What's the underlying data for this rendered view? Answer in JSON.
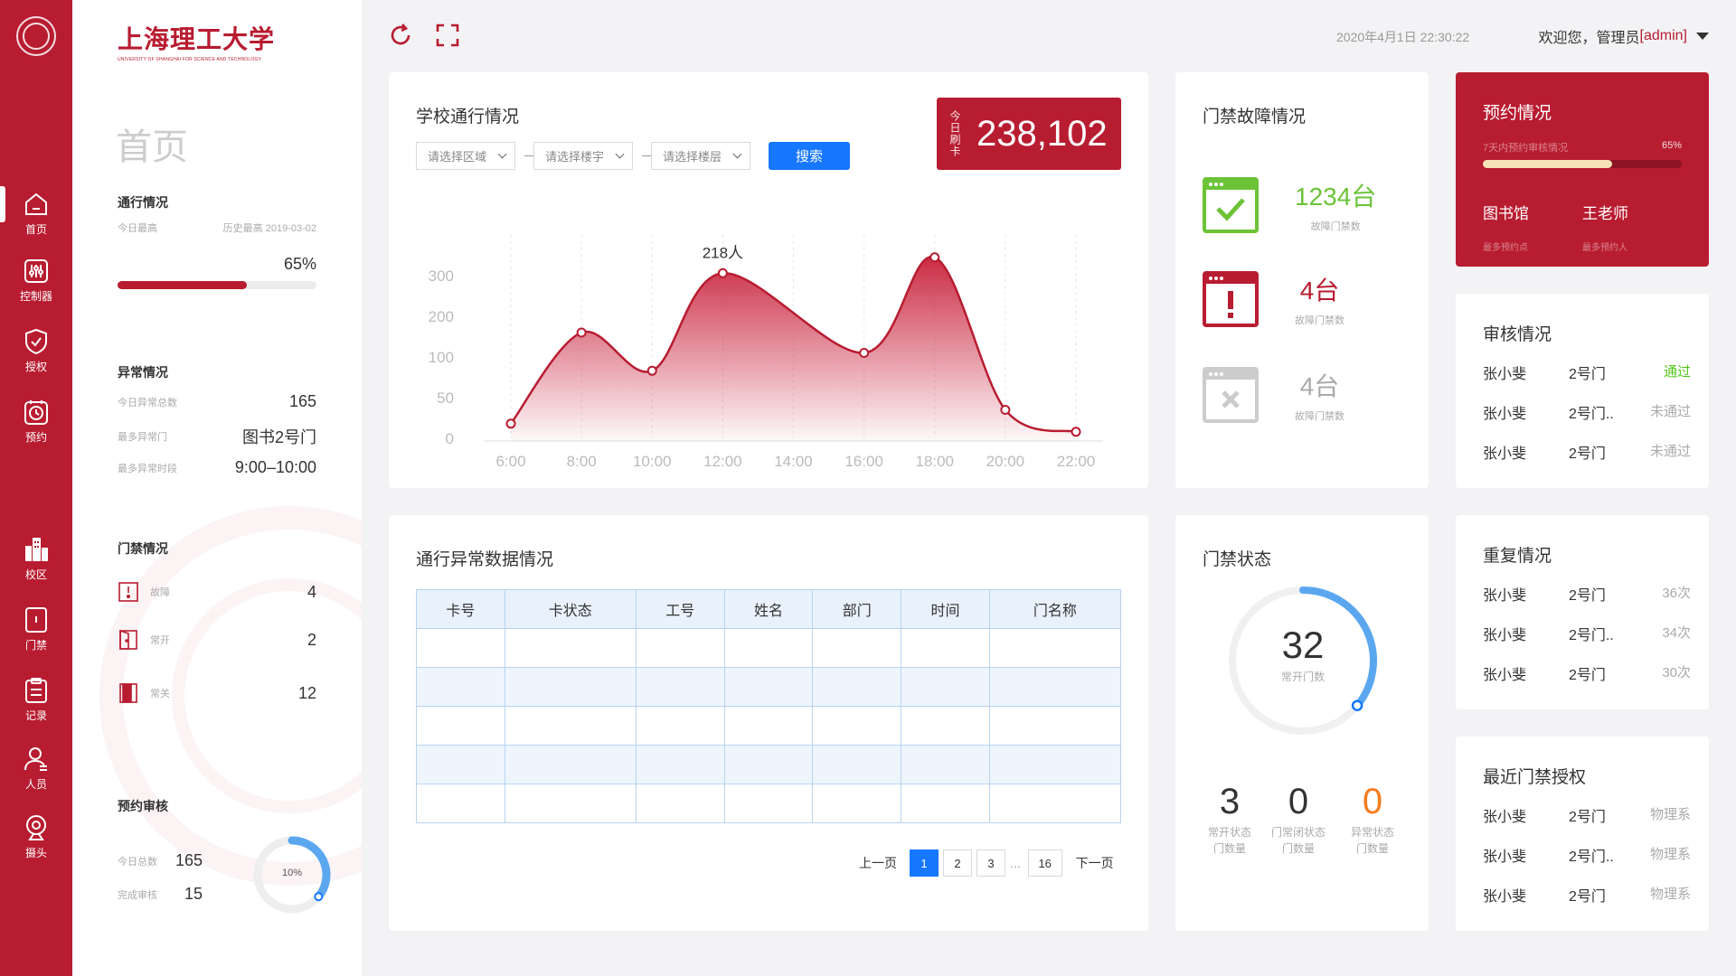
{
  "colors": {
    "brand": "#b81c30",
    "primary": "#1677ff",
    "success": "#52c41a",
    "warning": "#f57c1f",
    "fault_green": "#6cc337"
  },
  "nav": [
    {
      "label": "首页",
      "icon": "home-icon",
      "active": true
    },
    {
      "label": "控制器",
      "icon": "controller-icon"
    },
    {
      "label": "授权",
      "icon": "shield-icon"
    },
    {
      "label": "预约",
      "icon": "clock-icon"
    },
    {
      "label": "校区",
      "icon": "building-icon"
    },
    {
      "label": "门禁",
      "icon": "door-icon"
    },
    {
      "label": "记录",
      "icon": "clipboard-icon"
    },
    {
      "label": "人员",
      "icon": "person-icon"
    },
    {
      "label": "摄头",
      "icon": "camera-icon"
    }
  ],
  "brand": {
    "name_cn": "上海理工大学",
    "name_en": "UNIVERSITY OF SHANGHAI FOR SCIENCE AND TECHNOLOGY"
  },
  "sidebar": {
    "page_title": "首页",
    "traffic": {
      "title": "通行情况",
      "today_label": "今日最高",
      "history_label": "历史最高 2019-03-02",
      "percent_text": "65%",
      "percent": 0.65
    },
    "anomaly": {
      "title": "异常情况",
      "items": [
        {
          "label": "今日异常总数",
          "value": "165"
        },
        {
          "label": "最多异常门",
          "value": "图书2号门"
        },
        {
          "label": "最多异常时段",
          "value": "9:00–10:00"
        }
      ]
    },
    "doors": {
      "title": "门禁情况",
      "items": [
        {
          "label": "故障",
          "value": "4"
        },
        {
          "label": "常开",
          "value": "2"
        },
        {
          "label": "常关",
          "value": "12"
        }
      ]
    },
    "review": {
      "title": "预约审核",
      "total_label": "今日总数",
      "total_value": "165",
      "done_label": "完成审核",
      "done_value": "15",
      "percent_text": "10%",
      "percent": 0.1
    }
  },
  "topbar": {
    "datetime": "2020年4月1日 22:30:22",
    "welcome_prefix": "欢迎您，管理员",
    "welcome_user": "[admin]"
  },
  "traffic_card": {
    "title": "学校通行情况",
    "filters": [
      {
        "placeholder": "请选择区域"
      },
      {
        "placeholder": "请选择楼宇"
      },
      {
        "placeholder": "请选择楼层"
      }
    ],
    "search_label": "搜索",
    "counter_label": "今日刷卡",
    "counter_value": "238,102",
    "peak_label": "218人"
  },
  "chart_data": {
    "type": "area",
    "x": [
      "6:00",
      "8:00",
      "10:00",
      "12:00",
      "14:00",
      "16:00",
      "18:00",
      "20:00",
      "22:00"
    ],
    "x_hours": [
      6,
      8,
      10,
      12,
      14,
      16,
      18,
      20,
      22
    ],
    "points": [
      {
        "x": 6,
        "y": 18
      },
      {
        "x": 8,
        "y": 160
      },
      {
        "x": 10,
        "y": 83
      },
      {
        "x": 12,
        "y": 306
      },
      {
        "x": 16,
        "y": 110
      },
      {
        "x": 18,
        "y": 345
      },
      {
        "x": 20,
        "y": 35
      },
      {
        "x": 22,
        "y": 8
      }
    ],
    "y_ticks": [
      "0",
      "50",
      "100",
      "200",
      "300"
    ],
    "annotation": {
      "x": 12,
      "text": "218人"
    },
    "grid": "vertical dashed"
  },
  "anomaly_table": {
    "title": "通行异常数据情况",
    "columns": [
      "卡号",
      "卡状态",
      "工号",
      "姓名",
      "部门",
      "时间",
      "门名称"
    ],
    "rows": 5,
    "pager": {
      "prev": "上一页",
      "next": "下一页",
      "pages": [
        "1",
        "2",
        "3"
      ],
      "ellipsis": "...",
      "last": "16",
      "current": "1"
    }
  },
  "fault_card": {
    "title": "门禁故障情况",
    "items": [
      {
        "value": "1234台",
        "label": "故障门禁数",
        "color": "#6cc337",
        "icon": "check-window-icon"
      },
      {
        "value": "4台",
        "label": "故障门禁数",
        "color": "#b81c30",
        "icon": "alert-window-icon"
      },
      {
        "value": "4台",
        "label": "故障门禁数",
        "color": "#aaa",
        "icon": "error-window-icon"
      }
    ]
  },
  "door_status": {
    "title": "门禁状态",
    "center_value": "32",
    "center_label": "常开门数",
    "progress": 0.36,
    "stats": [
      {
        "value": "3",
        "label1": "常开状态",
        "label2": "门数量",
        "color": "#333"
      },
      {
        "value": "0",
        "label1": "门常闭状态",
        "label2": "门数量",
        "color": "#333"
      },
      {
        "value": "0",
        "label1": "异常状态",
        "label2": "门数量",
        "color": "#f57c1f"
      }
    ]
  },
  "reservation": {
    "title": "预约情况",
    "bar_label": "7天内预约审核情况",
    "bar_percent_text": "65%",
    "bar_percent": 0.65,
    "items": [
      {
        "value": "图书馆",
        "label": "最多预约点"
      },
      {
        "value": "王老师",
        "label": "最多预约人"
      }
    ]
  },
  "review_card": {
    "title": "审核情况",
    "rows": [
      {
        "name": "张小斐",
        "door": "2号门",
        "status": "通过",
        "ok": true
      },
      {
        "name": "张小斐",
        "door": "2号门..",
        "status": "未通过"
      },
      {
        "name": "张小斐",
        "door": "2号门",
        "status": "未通过"
      }
    ]
  },
  "repeat_card": {
    "title": "重复情况",
    "rows": [
      {
        "name": "张小斐",
        "door": "2号门",
        "count": "36次"
      },
      {
        "name": "张小斐",
        "door": "2号门..",
        "count": "34次"
      },
      {
        "name": "张小斐",
        "door": "2号门",
        "count": "30次"
      }
    ]
  },
  "recent_auth": {
    "title": "最近门禁授权",
    "rows": [
      {
        "name": "张小斐",
        "door": "2号门",
        "dept": "物理系"
      },
      {
        "name": "张小斐",
        "door": "2号门..",
        "dept": "物理系"
      },
      {
        "name": "张小斐",
        "door": "2号门",
        "dept": "物理系"
      }
    ]
  }
}
